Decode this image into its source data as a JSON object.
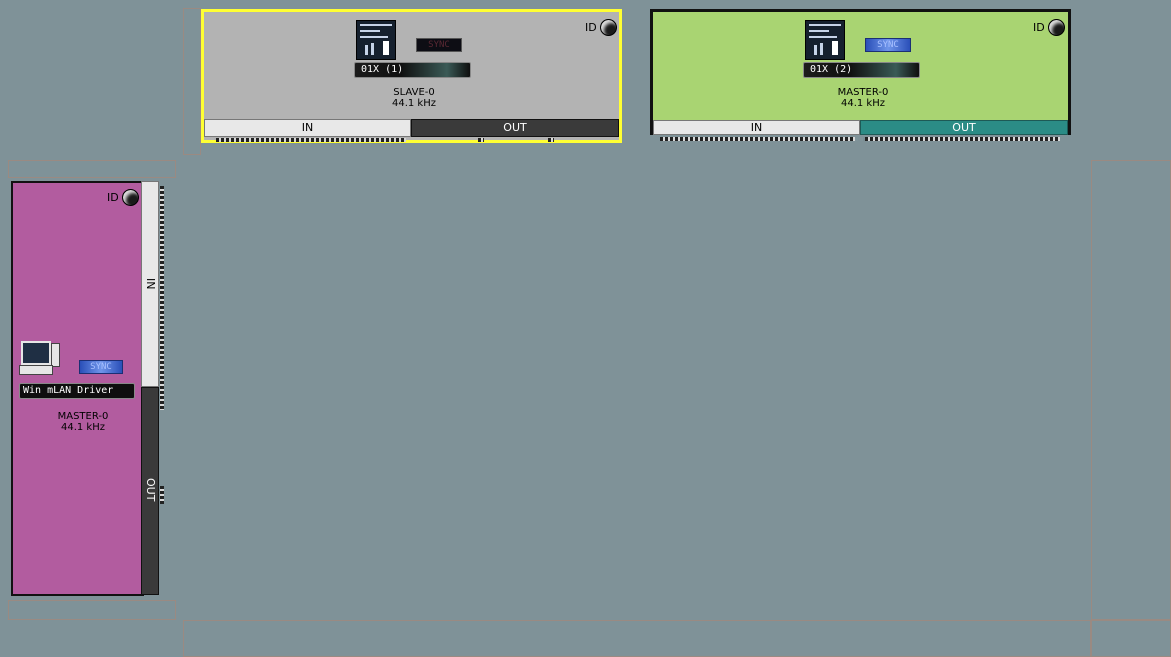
{
  "devices": {
    "slave": {
      "name": "01X (1)",
      "role": "SLAVE-0",
      "rate": "44.1 kHz",
      "id_label": "ID",
      "sync_label": "SYNC",
      "in_label": "IN",
      "out_label": "OUT",
      "selected": true,
      "color": "#b3b3b3"
    },
    "master_mixer": {
      "name": "01X (2)",
      "role": "MASTER-0",
      "rate": "44.1 kHz",
      "id_label": "ID",
      "sync_label": "SYNC",
      "in_label": "IN",
      "out_label": "OUT",
      "color": "#a9d472"
    },
    "pc_driver": {
      "name": "Win mLAN Driver",
      "role": "MASTER-0",
      "rate": "44.1 kHz",
      "id_label": "ID",
      "sync_label": "SYNC",
      "in_label": "IN",
      "out_label": "OUT",
      "color": "#b25c9f"
    }
  },
  "colors": {
    "background": "#7f9298",
    "selection_border": "#ffff33",
    "dark_border": "#111111"
  },
  "icons": {
    "mixer": "mixer-device-icon",
    "pc": "computer-icon",
    "id": "id-knob-icon"
  }
}
